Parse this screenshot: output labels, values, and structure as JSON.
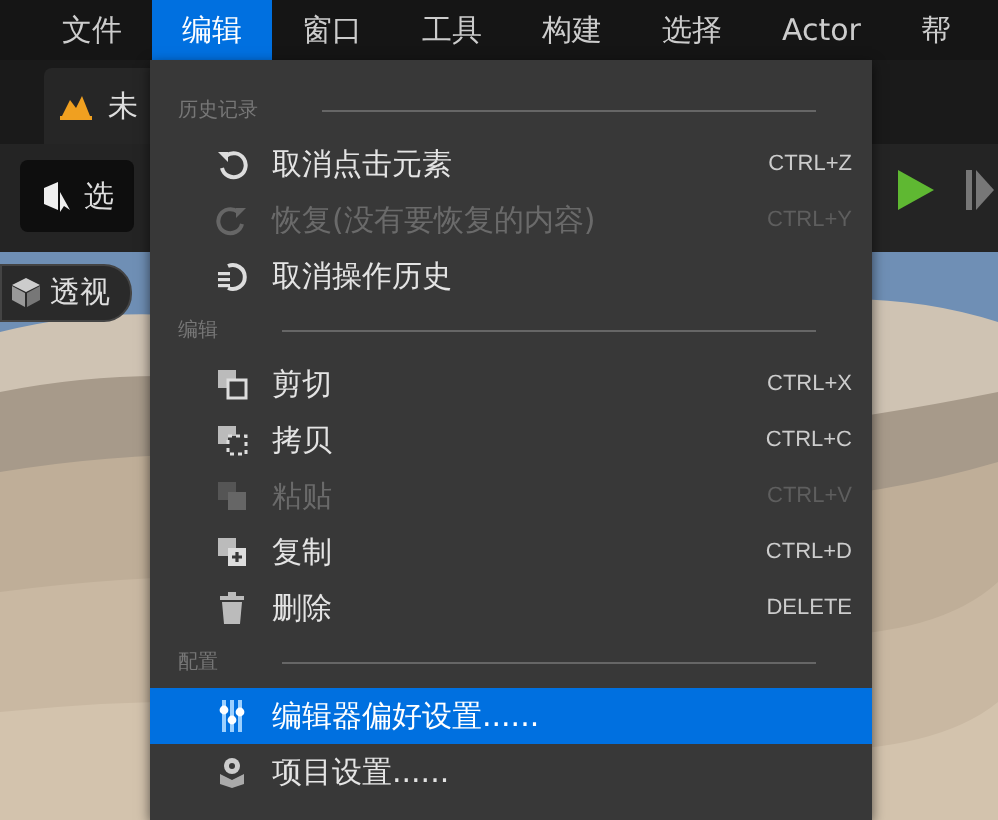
{
  "menubar": [
    {
      "label": "文件",
      "selected": false
    },
    {
      "label": "编辑",
      "selected": true
    },
    {
      "label": "窗口",
      "selected": false
    },
    {
      "label": "工具",
      "selected": false
    },
    {
      "label": "构建",
      "selected": false
    },
    {
      "label": "选择",
      "selected": false
    },
    {
      "label": "Actor",
      "selected": false
    },
    {
      "label": "帮",
      "selected": false
    }
  ],
  "level_tab": {
    "label": "未"
  },
  "toolbar": {
    "select_button": "选"
  },
  "viewport": {
    "view_mode": "透视"
  },
  "menu": {
    "sections": [
      {
        "title": "历史记录",
        "items": [
          {
            "label": "取消点击元素",
            "shortcut": "CTRL+Z",
            "disabled": false,
            "selected": false
          },
          {
            "label": "恢复(没有要恢复的内容)",
            "shortcut": "CTRL+Y",
            "disabled": true,
            "selected": false
          },
          {
            "label": "取消操作历史",
            "disabled": false,
            "selected": false
          }
        ]
      },
      {
        "title": "编辑",
        "items": [
          {
            "label": "剪切",
            "shortcut": "CTRL+X",
            "disabled": false,
            "selected": false
          },
          {
            "label": "拷贝",
            "shortcut": "CTRL+C",
            "disabled": false,
            "selected": false
          },
          {
            "label": "粘贴",
            "shortcut": "CTRL+V",
            "disabled": true,
            "selected": false
          },
          {
            "label": "复制",
            "shortcut": "CTRL+D",
            "disabled": false,
            "selected": false
          },
          {
            "label": "删除",
            "shortcut": "DELETE",
            "disabled": false,
            "selected": false
          }
        ]
      },
      {
        "title": "配置",
        "items": [
          {
            "label": "编辑器偏好设置......",
            "disabled": false,
            "selected": true
          },
          {
            "label": "项目设置......",
            "disabled": false,
            "selected": false
          }
        ]
      }
    ]
  }
}
